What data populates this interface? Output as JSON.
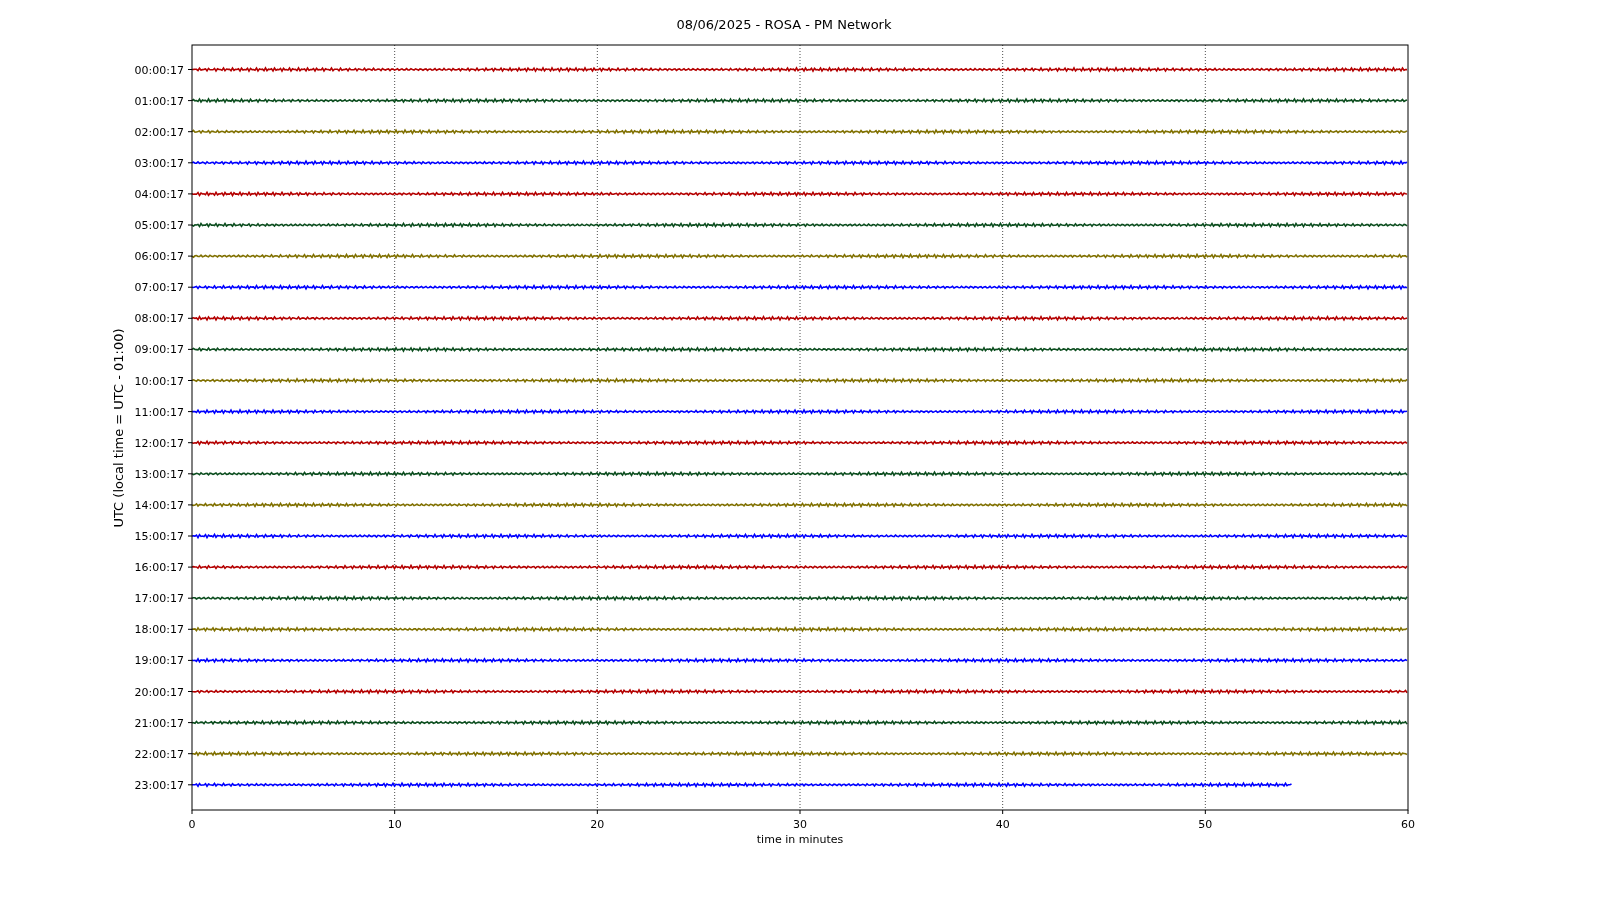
{
  "chart": {
    "title": "08/06/2025 - ROSA - PM Network",
    "ylabel": "UTC (local time = UTC - 01:00)",
    "xlabel": "time in minutes",
    "xticks": [
      "0",
      "10",
      "20",
      "30",
      "40",
      "50",
      "60"
    ],
    "rows": [
      {
        "label": "00:00:17",
        "color": "#b40000",
        "level": 1
      },
      {
        "label": "01:00:17",
        "color": "#0b4d1e",
        "level": 1
      },
      {
        "label": "02:00:17",
        "color": "#807000",
        "level": 1
      },
      {
        "label": "03:00:17",
        "color": "#0000ff",
        "level": 1
      },
      {
        "label": "04:00:17",
        "color": "#b40000",
        "level": 1
      },
      {
        "label": "05:00:17",
        "color": "#0b4d1e",
        "level": 1
      },
      {
        "label": "06:00:17",
        "color": "#807000",
        "level": 1
      },
      {
        "label": "07:00:17",
        "color": "#0000ff",
        "level": 1
      },
      {
        "label": "08:00:17",
        "color": "#b40000",
        "level": 1
      },
      {
        "label": "09:00:17",
        "color": "#0b4d1e",
        "level": 1
      },
      {
        "label": "10:00:17",
        "color": "#807000",
        "level": 1
      },
      {
        "label": "11:00:17",
        "color": "#0000ff",
        "level": 1
      },
      {
        "label": "12:00:17",
        "color": "#b40000",
        "level": 1
      },
      {
        "label": "13:00:17",
        "color": "#0b4d1e",
        "level": 1
      },
      {
        "label": "14:00:17",
        "color": "#807000",
        "level": 1
      },
      {
        "label": "15:00:17",
        "color": "#0000ff",
        "level": 1
      },
      {
        "label": "16:00:17",
        "color": "#b40000",
        "level": 1
      },
      {
        "label": "17:00:17",
        "color": "#0b4d1e",
        "level": 1
      },
      {
        "label": "18:00:17",
        "color": "#807000",
        "level": 1
      },
      {
        "label": "19:00:17",
        "color": "#0000ff",
        "level": 1
      },
      {
        "label": "20:00:17",
        "color": "#b40000",
        "level": 1
      },
      {
        "label": "21:00:17",
        "color": "#0b4d1e",
        "level": 1
      },
      {
        "label": "22:00:17",
        "color": "#807000",
        "level": 1
      },
      {
        "label": "23:00:17",
        "color": "#0000ff",
        "level": 0.905
      }
    ]
  }
}
